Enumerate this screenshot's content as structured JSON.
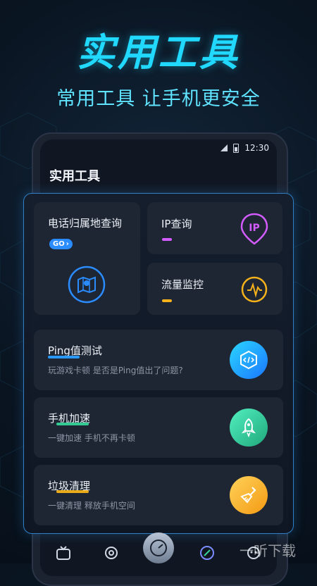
{
  "hero": {
    "title": "实用工具",
    "subtitle": "常用工具 让手机更安全"
  },
  "status": {
    "time": "12:30"
  },
  "app": {
    "title": "实用工具"
  },
  "tools": {
    "phone_location": {
      "label": "电话归属地查询",
      "badge": "GO",
      "icon": "map-pin-icon"
    },
    "ip_query": {
      "label": "IP查询",
      "icon_text": "IP",
      "icon": "ip-pin-icon",
      "accent": "#d35cff"
    },
    "traffic_monitor": {
      "label": "流量监控",
      "icon": "pulse-icon",
      "accent": "#f5b21a"
    },
    "ping_test": {
      "label": "Ping值测试",
      "desc": "玩游戏卡顿 是否是Ping值出了问题?",
      "icon": "code-cube-icon",
      "accent": "#2a9dff"
    },
    "phone_boost": {
      "label": "手机加速",
      "desc": "一键加速 手机不再卡顿",
      "icon": "rocket-icon",
      "accent": "#34d399"
    },
    "junk_clean": {
      "label": "垃圾清理",
      "desc": "一键清理 释放手机空间",
      "icon": "broom-icon",
      "accent": "#f6b21a"
    }
  },
  "bottom_nav": [
    "tv-icon",
    "target-icon",
    "speedometer-icon",
    "tools-icon",
    "robot-icon"
  ],
  "watermark": {
    "text": "一听下载"
  }
}
